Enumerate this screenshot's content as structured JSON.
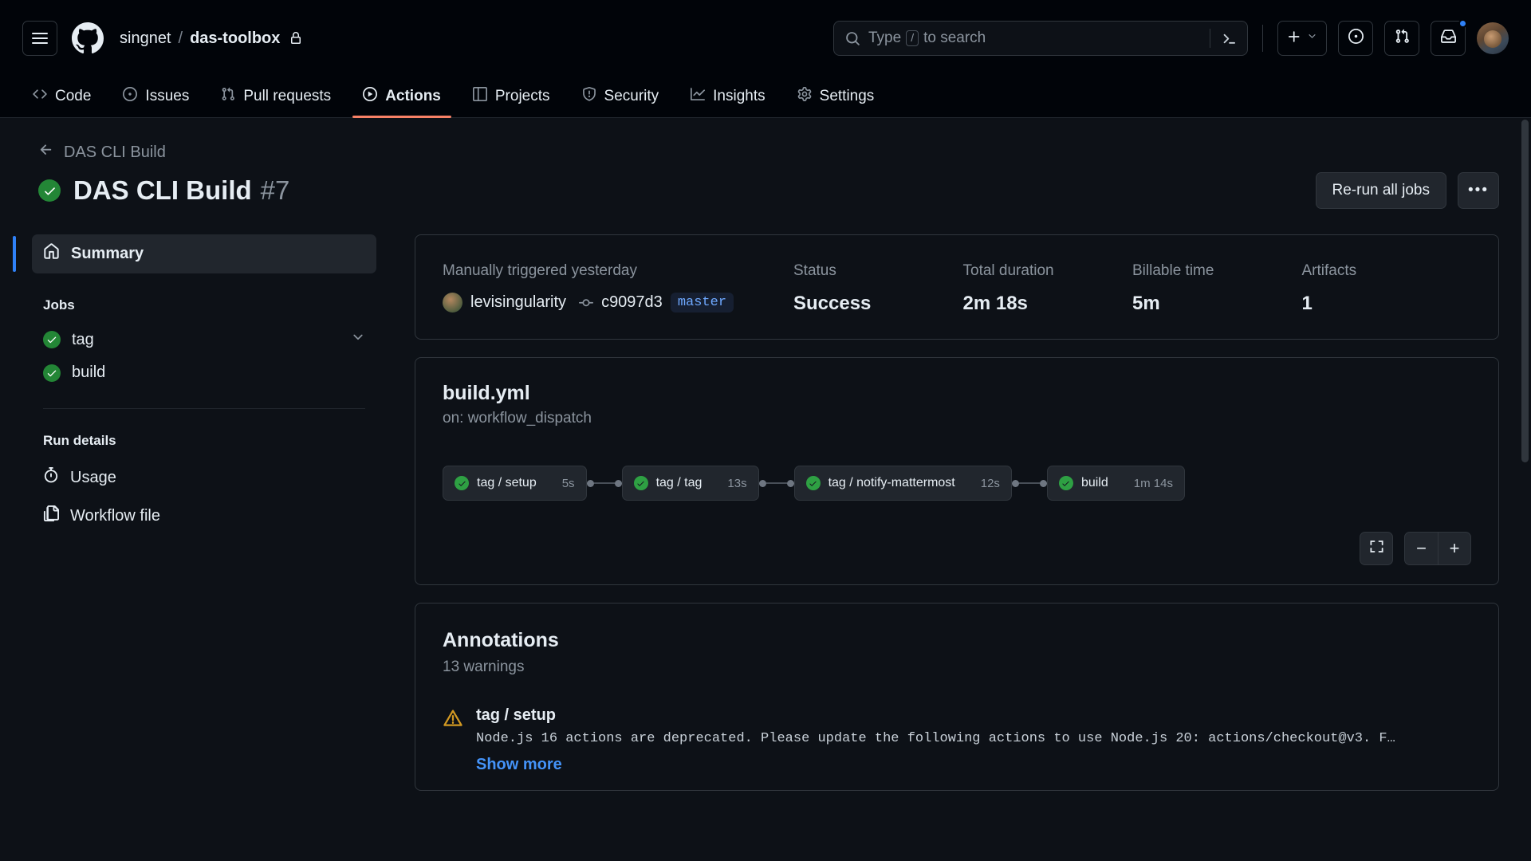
{
  "header": {
    "menu_icon": "hamburger-menu-icon",
    "logo_icon": "github-logo-icon",
    "owner": "singnet",
    "separator": "/",
    "repo": "das-toolbox",
    "lock_icon": "lock-icon",
    "search": {
      "placeholder_prefix": "Type",
      "slash_key": "/",
      "placeholder_suffix": "to search",
      "search_icon": "search-icon",
      "terminal_icon": "terminal-icon"
    },
    "create_new_label": "+",
    "create_new_icon": "plus-icon",
    "chevron_icon": "chevron-down-icon",
    "issues_icon": "issues-dot-icon",
    "pull_requests_icon": "pull-request-icon",
    "inbox_icon": "inbox-icon",
    "avatar_icon": "user-avatar"
  },
  "nav": {
    "tabs": [
      {
        "label": "Code",
        "icon": "code-icon",
        "active": false
      },
      {
        "label": "Issues",
        "icon": "issue-opened-icon",
        "active": false
      },
      {
        "label": "Pull requests",
        "icon": "git-pull-request-icon",
        "active": false
      },
      {
        "label": "Actions",
        "icon": "play-icon",
        "active": true
      },
      {
        "label": "Projects",
        "icon": "table-icon",
        "active": false
      },
      {
        "label": "Security",
        "icon": "shield-icon",
        "active": false
      },
      {
        "label": "Insights",
        "icon": "graph-icon",
        "active": false
      },
      {
        "label": "Settings",
        "icon": "gear-icon",
        "active": false
      }
    ]
  },
  "run": {
    "back_label": "DAS CLI Build",
    "back_icon": "arrow-left-icon",
    "status_icon": "check-circle-icon",
    "title": "DAS CLI Build",
    "number": "#7",
    "rerun_label": "Re-run all jobs",
    "kebab_label": "•••"
  },
  "sidebar": {
    "summary": {
      "label": "Summary",
      "icon": "home-icon"
    },
    "jobs_header": "Jobs",
    "jobs": [
      {
        "label": "tag",
        "icon": "check-circle-icon",
        "expandable": true
      },
      {
        "label": "build",
        "icon": "check-circle-icon",
        "expandable": false
      }
    ],
    "run_details_header": "Run details",
    "details": [
      {
        "label": "Usage",
        "icon": "stopwatch-icon"
      },
      {
        "label": "Workflow file",
        "icon": "file-code-icon"
      }
    ]
  },
  "summary": {
    "trigger_text": "Manually triggered yesterday",
    "actor": "levisingularity",
    "commit_icon": "git-commit-icon",
    "commit_sha": "c9097d3",
    "branch": "master",
    "metrics": [
      {
        "label": "Status",
        "value": "Success"
      },
      {
        "label": "Total duration",
        "value": "2m 18s"
      },
      {
        "label": "Billable time",
        "value": "5m"
      },
      {
        "label": "Artifacts",
        "value": "1"
      }
    ]
  },
  "workflow": {
    "file_name": "build.yml",
    "trigger": "on: workflow_dispatch",
    "nodes": [
      {
        "label": "tag / setup",
        "duration": "5s",
        "status": "success"
      },
      {
        "label": "tag / tag",
        "duration": "13s",
        "status": "success"
      },
      {
        "label": "tag / notify-mattermost",
        "duration": "12s",
        "status": "success"
      },
      {
        "label": "build",
        "duration": "1m 14s",
        "status": "success"
      }
    ],
    "controls": {
      "fullscreen_icon": "fullscreen-icon",
      "zoom_out_label": "−",
      "zoom_in_label": "+"
    }
  },
  "annotations": {
    "title": "Annotations",
    "subtitle": "13 warnings",
    "items": [
      {
        "warn_icon": "warning-triangle-icon",
        "job": "tag / setup",
        "message": "Node.js 16 actions are deprecated. Please update the following actions to use Node.js 20: actions/checkout@v3. F…",
        "show_more": "Show more"
      }
    ]
  },
  "colors": {
    "accent": "#2f81f7",
    "success": "#238636",
    "active_tab": "#f78166",
    "warning": "#d29922",
    "link": "#4493f8",
    "branch_text": "#6ea8fe"
  }
}
